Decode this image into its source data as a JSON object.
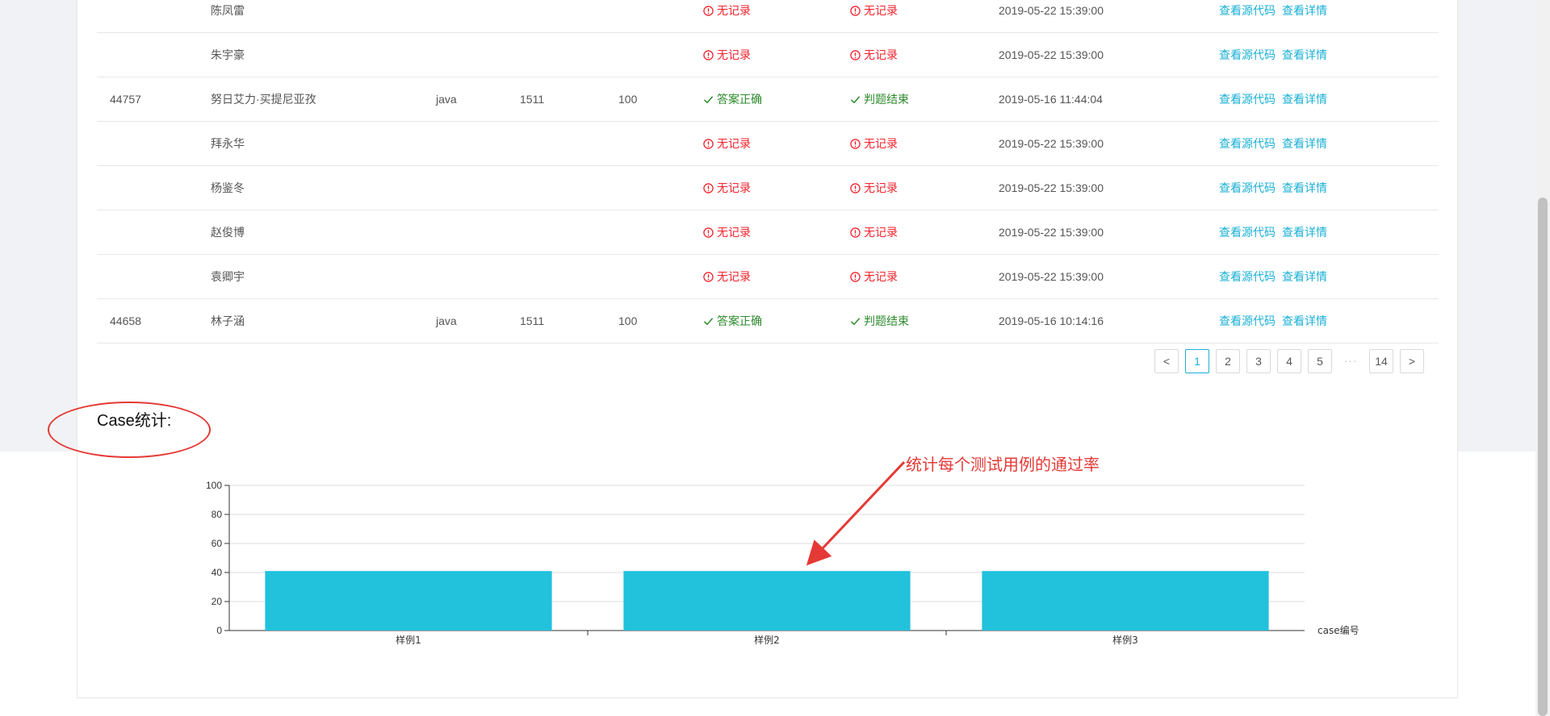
{
  "table": {
    "rows": [
      {
        "id": "",
        "name": "陈凤雷",
        "lang": "",
        "problem": "",
        "score": "",
        "status": "无记录",
        "status_type": "red",
        "judge": "无记录",
        "judge_type": "red",
        "time": "2019-05-22 15:39:00",
        "op_code": "查看源代码",
        "op_detail": "查看详情"
      },
      {
        "id": "",
        "name": "朱宇豪",
        "lang": "",
        "problem": "",
        "score": "",
        "status": "无记录",
        "status_type": "red",
        "judge": "无记录",
        "judge_type": "red",
        "time": "2019-05-22 15:39:00",
        "op_code": "查看源代码",
        "op_detail": "查看详情"
      },
      {
        "id": "44757",
        "name": "努日艾力·买提尼亚孜",
        "lang": "java",
        "problem": "1511",
        "score": "100",
        "status": "答案正确",
        "status_type": "green",
        "judge": "判题结束",
        "judge_type": "green",
        "time": "2019-05-16 11:44:04",
        "op_code": "查看源代码",
        "op_detail": "查看详情"
      },
      {
        "id": "",
        "name": "拜永华",
        "lang": "",
        "problem": "",
        "score": "",
        "status": "无记录",
        "status_type": "red",
        "judge": "无记录",
        "judge_type": "red",
        "time": "2019-05-22 15:39:00",
        "op_code": "查看源代码",
        "op_detail": "查看详情"
      },
      {
        "id": "",
        "name": "杨鉴冬",
        "lang": "",
        "problem": "",
        "score": "",
        "status": "无记录",
        "status_type": "red",
        "judge": "无记录",
        "judge_type": "red",
        "time": "2019-05-22 15:39:00",
        "op_code": "查看源代码",
        "op_detail": "查看详情"
      },
      {
        "id": "",
        "name": "赵俊博",
        "lang": "",
        "problem": "",
        "score": "",
        "status": "无记录",
        "status_type": "red",
        "judge": "无记录",
        "judge_type": "red",
        "time": "2019-05-22 15:39:00",
        "op_code": "查看源代码",
        "op_detail": "查看详情"
      },
      {
        "id": "",
        "name": "袁卿宇",
        "lang": "",
        "problem": "",
        "score": "",
        "status": "无记录",
        "status_type": "red",
        "judge": "无记录",
        "judge_type": "red",
        "time": "2019-05-22 15:39:00",
        "op_code": "查看源代码",
        "op_detail": "查看详情"
      },
      {
        "id": "44658",
        "name": "林子涵",
        "lang": "java",
        "problem": "1511",
        "score": "100",
        "status": "答案正确",
        "status_type": "green",
        "judge": "判题结束",
        "judge_type": "green",
        "time": "2019-05-16 10:14:16",
        "op_code": "查看源代码",
        "op_detail": "查看详情"
      }
    ]
  },
  "pagination": {
    "prev": "<",
    "pages": [
      "1",
      "2",
      "3",
      "4",
      "5"
    ],
    "ellipsis": "···",
    "last": "14",
    "next": ">",
    "current": "1"
  },
  "case_section": {
    "title": "Case统计:",
    "annotation": "统计每个测试用例的通过率"
  },
  "colors": {
    "bar": "#22c1dc",
    "link": "#1ab0d5",
    "error": "#f5222d",
    "success": "#2c8a2c",
    "annotation": "#e53935"
  },
  "chart_data": {
    "type": "bar",
    "categories": [
      "样例1",
      "样例2",
      "样例3"
    ],
    "values": [
      41,
      41,
      41
    ],
    "xlabel": "case编号",
    "ylabel": "",
    "ylim": [
      0,
      100
    ],
    "yticks": [
      0,
      20,
      40,
      60,
      80,
      100
    ],
    "grid": true
  }
}
